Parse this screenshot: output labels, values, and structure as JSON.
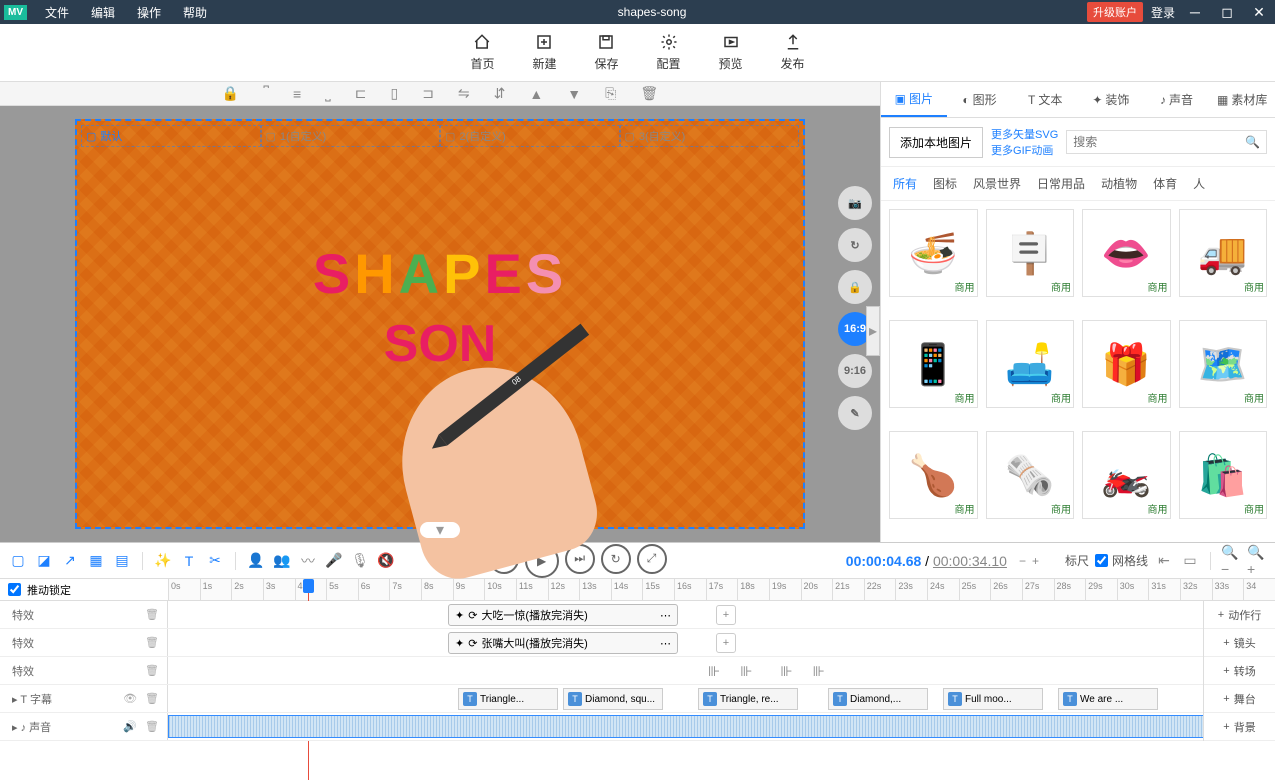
{
  "app": {
    "logo": "MV",
    "title": "shapes-song"
  },
  "menu": [
    "文件",
    "编辑",
    "操作",
    "帮助"
  ],
  "titlebar_right": {
    "upgrade": "升级账户",
    "login": "登录"
  },
  "main_tools": [
    "首页",
    "新建",
    "保存",
    "配置",
    "预览",
    "发布"
  ],
  "scenes": [
    "默认",
    "1(自定义)",
    "2(自定义)",
    "3(自定义)"
  ],
  "canvas_text": {
    "line1": "SHAPES",
    "line2": "SON"
  },
  "pen_label": "08",
  "aspect_ratios": {
    "r1": "16:9",
    "r2": "9:16"
  },
  "panel_tabs": [
    "图片",
    "图形",
    "文本",
    "装饰",
    "声音",
    "素材库"
  ],
  "panel_header": {
    "add_button": "添加本地图片",
    "link1": "更多矢量SVG",
    "link2": "更多GIF动画",
    "search_placeholder": "搜索"
  },
  "filters": [
    "所有",
    "图标",
    "风景世界",
    "日常用品",
    "动植物",
    "体育",
    "人"
  ],
  "asset_badge": "商用",
  "assets": [
    "🍜",
    "🪧",
    "👄",
    "🚚",
    "📱",
    "🛋️",
    "🎁",
    "🗺️",
    "🍗",
    "🗞️",
    "🏍️",
    "🛍️"
  ],
  "time": {
    "current": "00:00:04.68",
    "total": "00:00:34.10"
  },
  "tl_labels": {
    "ruler_label": "标尺",
    "gridline": "网格线",
    "lock": "推动锁定"
  },
  "rows": {
    "fx": "特效",
    "subtitle": "字幕",
    "audio": "声音"
  },
  "clips": {
    "c1": "大吃一惊(播放完消失)",
    "c2": "张嘴大叫(播放完消失)"
  },
  "captions": [
    "Triangle...",
    "Diamond, squ...",
    "Triangle, re...",
    "Diamond,...",
    "Full moo...",
    "We are ..."
  ],
  "right_buttons": [
    "动作行",
    "镜头",
    "转场",
    "舞台",
    "背景"
  ],
  "ticks": [
    "0s",
    "1s",
    "2s",
    "3s",
    "4s",
    "5s",
    "6s",
    "7s",
    "8s",
    "9s",
    "10s",
    "11s",
    "12s",
    "13s",
    "14s",
    "15s",
    "16s",
    "17s",
    "18s",
    "19s",
    "20s",
    "21s",
    "22s",
    "23s",
    "24s",
    "25s",
    "26s",
    "27s",
    "28s",
    "29s",
    "30s",
    "31s",
    "32s",
    "33s",
    "34"
  ]
}
